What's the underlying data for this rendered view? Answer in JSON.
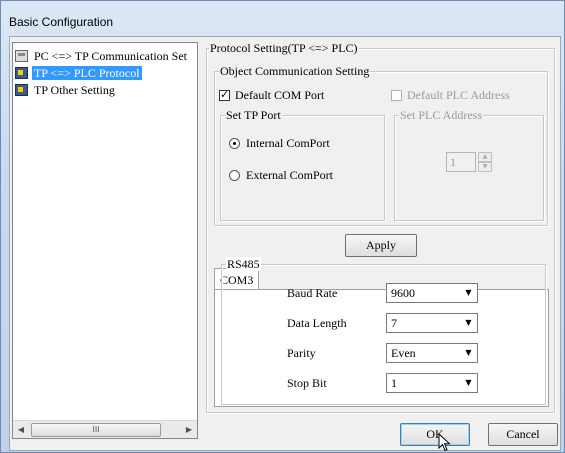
{
  "window": {
    "title": "Basic Configuration"
  },
  "tree": {
    "items": [
      {
        "label": "PC <=> TP Communication Set",
        "icon": "pc-link-icon",
        "selected": false
      },
      {
        "label": "TP <=> PLC Protocol",
        "icon": "tp-device-icon",
        "selected": true
      },
      {
        "label": "TP Other Setting",
        "icon": "tp-device-icon",
        "selected": false
      }
    ],
    "scroll_thumb": "III"
  },
  "protocol": {
    "title": "Protocol Setting(TP <=> PLC)",
    "object_comm": {
      "title": "Object Communication Setting",
      "default_com_port": {
        "label": "Default COM Port",
        "checked": true
      },
      "default_plc_address": {
        "label": "Default PLC Address",
        "checked": false,
        "enabled": false
      },
      "set_tp_port": {
        "title": "Set TP Port",
        "internal": {
          "label": "Internal ComPort",
          "selected": true
        },
        "external": {
          "label": "External ComPort",
          "selected": false
        }
      },
      "set_plc_address": {
        "title": "Set PLC Address",
        "value": "1"
      }
    },
    "apply_label": "Apply",
    "tab_label": "COM3",
    "rs485": {
      "title": "RS485",
      "baud_rate": {
        "label": "Baud Rate",
        "value": "9600"
      },
      "data_length": {
        "label": "Data Length",
        "value": "7"
      },
      "parity": {
        "label": "Parity",
        "value": "Even"
      },
      "stop_bit": {
        "label": "Stop Bit",
        "value": "1"
      }
    }
  },
  "footer": {
    "ok_label": "OK",
    "cancel_label": "Cancel"
  }
}
